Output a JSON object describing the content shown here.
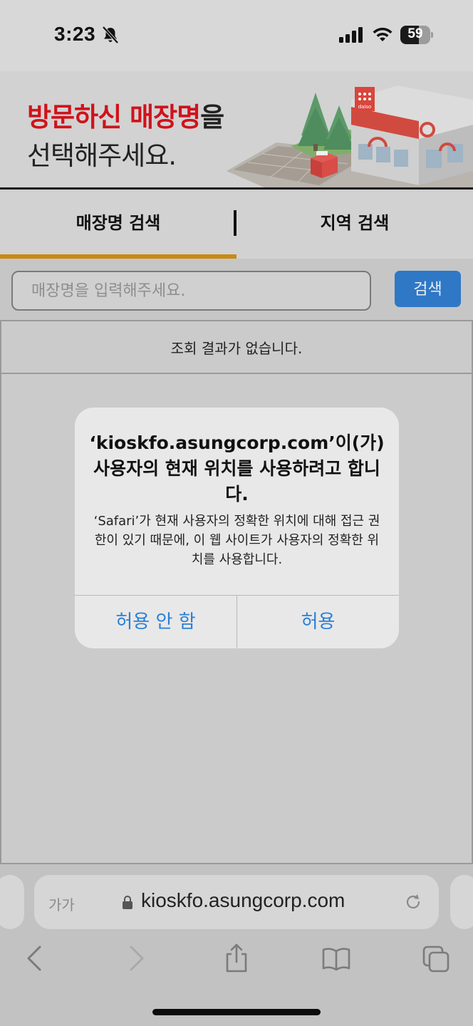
{
  "status": {
    "time": "3:23",
    "battery": "59",
    "icons": [
      "bell-slash-icon",
      "cellular-signal-icon",
      "wifi-icon",
      "battery-icon"
    ]
  },
  "banner": {
    "line1_red": "방문하신 매장명",
    "line1_rest": "을",
    "line2": "선택해주세요.",
    "store_sign": "daiso"
  },
  "tabs": [
    {
      "label": "매장명 검색",
      "active": true
    },
    {
      "label": "지역 검색",
      "active": false
    }
  ],
  "search": {
    "placeholder": "매장명을 입력해주세요.",
    "value": "",
    "button_label": "검색"
  },
  "results": {
    "empty_message": "조회 결과가 없습니다."
  },
  "dialog": {
    "title": "‘kioskfo.asungcorp.com’이(가) 사용자의 현재 위치를 사용하려고 합니다.",
    "message": "‘Safari’가 현재 사용자의 정확한 위치에 대해 접근 권한이 있기 때문에, 이 웹 사이트가 사용자의 정확한 위치를 사용합니다.",
    "deny_label": "허용 안 함",
    "allow_label": "허용"
  },
  "safari": {
    "text_size_label": "가가",
    "url": "kioskfo.asungcorp.com",
    "toolbar": [
      "back-icon",
      "forward-icon",
      "share-icon",
      "bookmarks-icon",
      "tabs-icon"
    ]
  },
  "colors": {
    "accent_red": "#d0121b",
    "tab_underline": "#c98a12",
    "search_button": "#2f78c6",
    "ios_link": "#2a7fd6"
  }
}
